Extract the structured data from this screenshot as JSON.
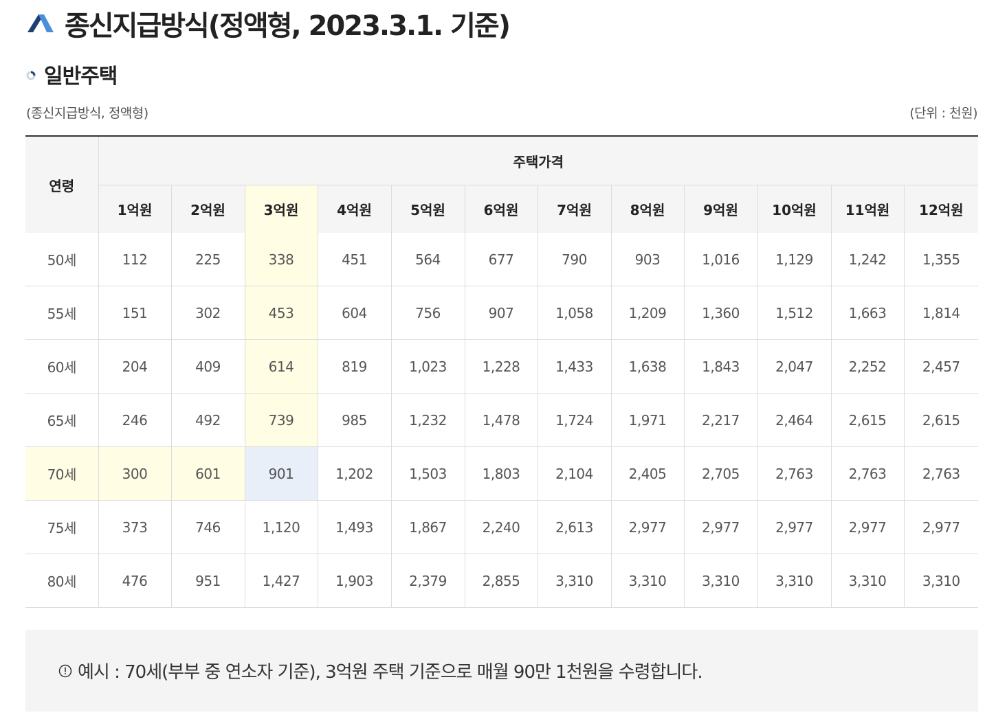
{
  "header": {
    "title": "종신지급방식(정액형, 2023.3.1. 기준)",
    "section": "일반주택",
    "caption": "(종신지급방식, 정액형)",
    "unit": "(단위 : 천원)"
  },
  "table": {
    "age_header": "연령",
    "price_header": "주택가격",
    "price_columns": [
      "1억원",
      "2억원",
      "3억원",
      "4억원",
      "5억원",
      "6억원",
      "7억원",
      "8억원",
      "9억원",
      "10억원",
      "11억원",
      "12억원"
    ],
    "rows": [
      {
        "age": "50세",
        "values": [
          "112",
          "225",
          "338",
          "451",
          "564",
          "677",
          "790",
          "903",
          "1,016",
          "1,129",
          "1,242",
          "1,355"
        ]
      },
      {
        "age": "55세",
        "values": [
          "151",
          "302",
          "453",
          "604",
          "756",
          "907",
          "1,058",
          "1,209",
          "1,360",
          "1,512",
          "1,663",
          "1,814"
        ]
      },
      {
        "age": "60세",
        "values": [
          "204",
          "409",
          "614",
          "819",
          "1,023",
          "1,228",
          "1,433",
          "1,638",
          "1,843",
          "2,047",
          "2,252",
          "2,457"
        ]
      },
      {
        "age": "65세",
        "values": [
          "246",
          "492",
          "739",
          "985",
          "1,232",
          "1,478",
          "1,724",
          "1,971",
          "2,217",
          "2,464",
          "2,615",
          "2,615"
        ]
      },
      {
        "age": "70세",
        "values": [
          "300",
          "601",
          "901",
          "1,202",
          "1,503",
          "1,803",
          "2,104",
          "2,405",
          "2,705",
          "2,763",
          "2,763",
          "2,763"
        ]
      },
      {
        "age": "75세",
        "values": [
          "373",
          "746",
          "1,120",
          "1,493",
          "1,867",
          "2,240",
          "2,613",
          "2,977",
          "2,977",
          "2,977",
          "2,977",
          "2,977"
        ]
      },
      {
        "age": "80세",
        "values": [
          "476",
          "951",
          "1,427",
          "1,903",
          "2,379",
          "2,855",
          "3,310",
          "3,310",
          "3,310",
          "3,310",
          "3,310",
          "3,310"
        ]
      }
    ]
  },
  "note": {
    "icon": "info-circle-icon",
    "text": "예시 : 70세(부부 중 연소자 기준), 3억원 주택 기준으로 매월 90만 1천원을 수령합니다."
  },
  "colors": {
    "highlight_yellow": "#fffde4",
    "highlight_blue": "#e8eff9",
    "logo_dark": "#1f3f74",
    "logo_light": "#4a90d9"
  }
}
